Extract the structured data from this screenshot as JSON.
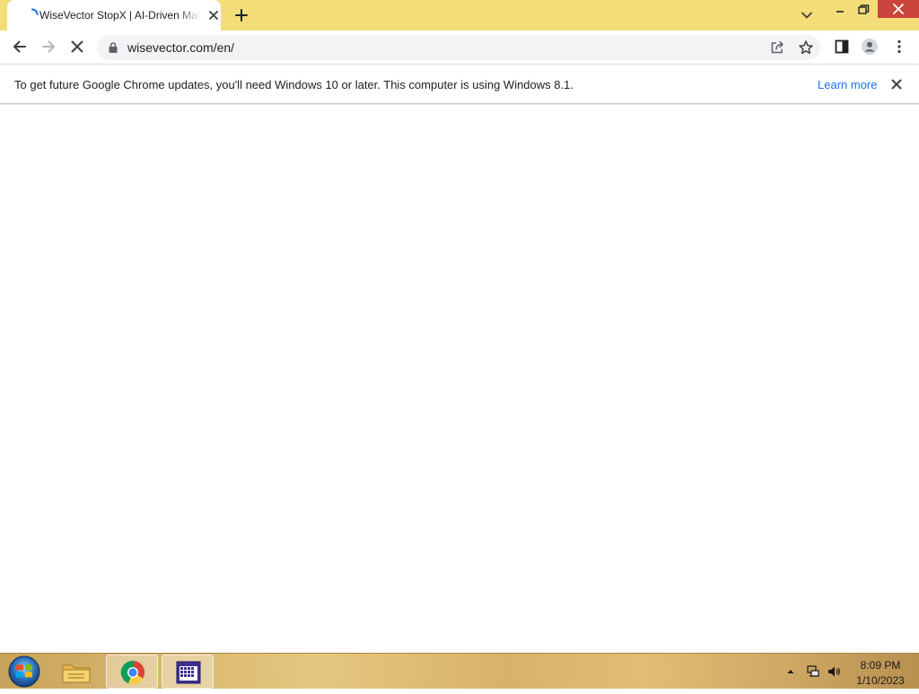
{
  "browser": {
    "tab": {
      "title": "WiseVector StopX | AI-Driven Malware Protection"
    },
    "address_bar": {
      "url": "wisevector.com/en/"
    },
    "colors": {
      "tabstrip": "#f4dd78",
      "close_button": "#c9443a"
    },
    "infobar": {
      "message": "To get future Google Chrome updates, you'll need Windows 10 or later. This computer is using Windows 8.1.",
      "link": "Learn more"
    }
  },
  "taskbar": {
    "apps": [
      "start-orb-icon",
      "file-explorer-icon",
      "chrome-icon",
      "calendar-app-icon"
    ],
    "clock": {
      "time": "8:09 PM",
      "date": "1/10/2023"
    }
  }
}
